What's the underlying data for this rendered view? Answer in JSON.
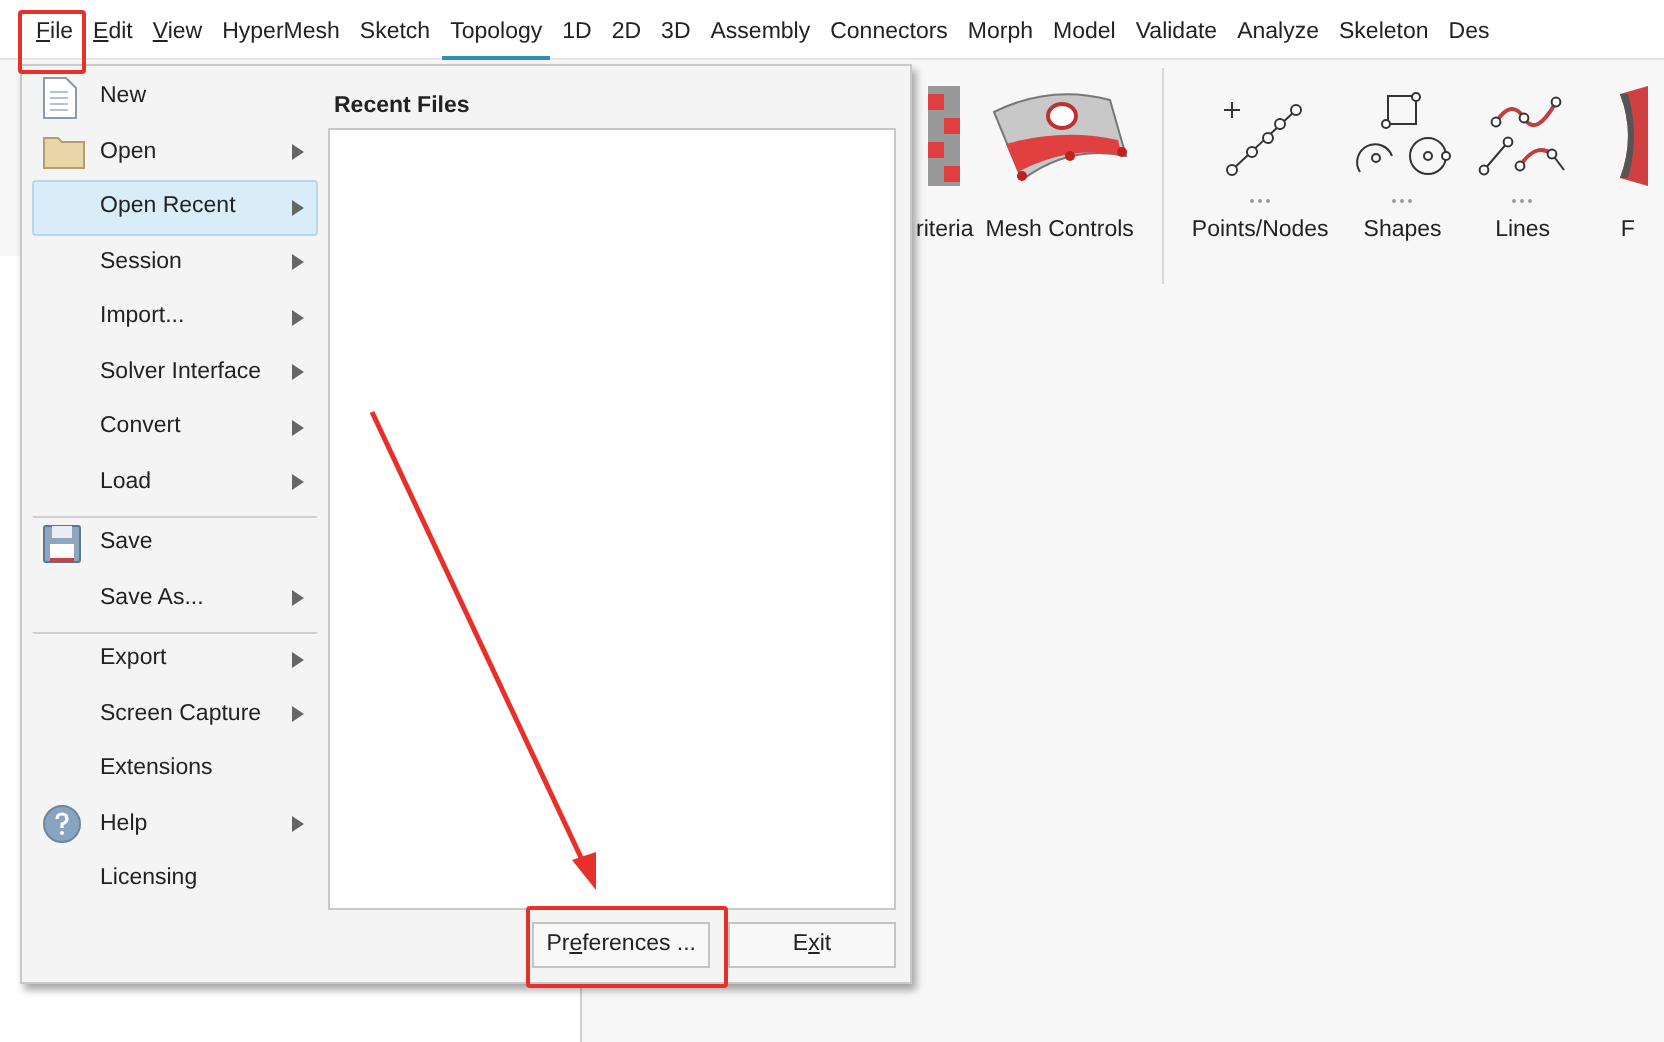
{
  "menubar": [
    {
      "label": {
        "underlined": "F",
        "after": "ile"
      },
      "selected": false
    },
    {
      "label": {
        "underlined": "E",
        "after": "dit"
      },
      "selected": false
    },
    {
      "label": {
        "underlined": "V",
        "after": "iew"
      },
      "selected": false
    },
    {
      "label": {
        "before": "HyperMesh"
      },
      "selected": false
    },
    {
      "label": {
        "before": "Sketch"
      },
      "selected": false
    },
    {
      "label": {
        "before": "Topology"
      },
      "selected": true
    },
    {
      "label": {
        "before": "1D"
      },
      "selected": false
    },
    {
      "label": {
        "before": "2D"
      },
      "selected": false
    },
    {
      "label": {
        "before": "3D"
      },
      "selected": false
    },
    {
      "label": {
        "before": "Assembly"
      },
      "selected": false
    },
    {
      "label": {
        "before": "Connectors"
      },
      "selected": false
    },
    {
      "label": {
        "before": "Morph"
      },
      "selected": false
    },
    {
      "label": {
        "before": "Model"
      },
      "selected": false
    },
    {
      "label": {
        "before": "Validate"
      },
      "selected": false
    },
    {
      "label": {
        "before": "Analyze"
      },
      "selected": false
    },
    {
      "label": {
        "before": "Skeleton"
      },
      "selected": false
    },
    {
      "label": {
        "before": "Des"
      },
      "selected": false
    }
  ],
  "ribbon": {
    "tools": [
      {
        "kind": "criteria",
        "label": "riteria"
      },
      {
        "kind": "mesh",
        "label": "Mesh Controls"
      },
      {
        "kind": "divider"
      },
      {
        "kind": "points",
        "label": "Points/Nodes"
      },
      {
        "kind": "shapes",
        "label": "Shapes"
      },
      {
        "kind": "lines",
        "label": "Lines"
      },
      {
        "kind": "surface",
        "label": "F"
      }
    ]
  },
  "file_menu": {
    "items": [
      {
        "kind": "document",
        "label": "New",
        "submenu": false,
        "selected": false,
        "separator_before": false
      },
      {
        "kind": "folder",
        "label": "Open",
        "submenu": true,
        "selected": false,
        "separator_before": false
      },
      {
        "kind": "plain",
        "label": "Open Recent",
        "submenu": true,
        "selected": true,
        "separator_before": false
      },
      {
        "kind": "plain",
        "label": "Session",
        "submenu": true,
        "selected": false,
        "separator_before": false
      },
      {
        "kind": "plain",
        "label": "Import...",
        "submenu": true,
        "selected": false,
        "separator_before": false
      },
      {
        "kind": "plain",
        "label": "Solver Interface",
        "submenu": true,
        "selected": false,
        "separator_before": false
      },
      {
        "kind": "plain",
        "label": "Convert",
        "submenu": true,
        "selected": false,
        "separator_before": false
      },
      {
        "kind": "plain",
        "label": "Load",
        "submenu": true,
        "selected": false,
        "separator_before": false
      },
      {
        "kind": "floppy",
        "label": "Save",
        "submenu": false,
        "selected": false,
        "separator_before": true
      },
      {
        "kind": "plain",
        "label": "Save As...",
        "submenu": true,
        "selected": false,
        "separator_before": false
      },
      {
        "kind": "plain",
        "label": "Export",
        "submenu": true,
        "selected": false,
        "separator_before": true
      },
      {
        "kind": "plain",
        "label": "Screen Capture",
        "submenu": true,
        "selected": false,
        "separator_before": false
      },
      {
        "kind": "plain",
        "label": "Extensions",
        "submenu": false,
        "selected": false,
        "separator_before": false
      },
      {
        "kind": "help",
        "label": "Help",
        "submenu": true,
        "selected": false,
        "separator_before": false
      },
      {
        "kind": "plain",
        "label": "Licensing",
        "submenu": false,
        "selected": false,
        "separator_before": false
      }
    ],
    "recent_files": {
      "title": "Recent Files"
    },
    "buttons": [
      {
        "label": {
          "before": "Pr",
          "underlined": "e",
          "after": "ferences ..."
        }
      },
      {
        "label": {
          "before": "E",
          "underlined": "x",
          "after": "it"
        }
      }
    ]
  }
}
